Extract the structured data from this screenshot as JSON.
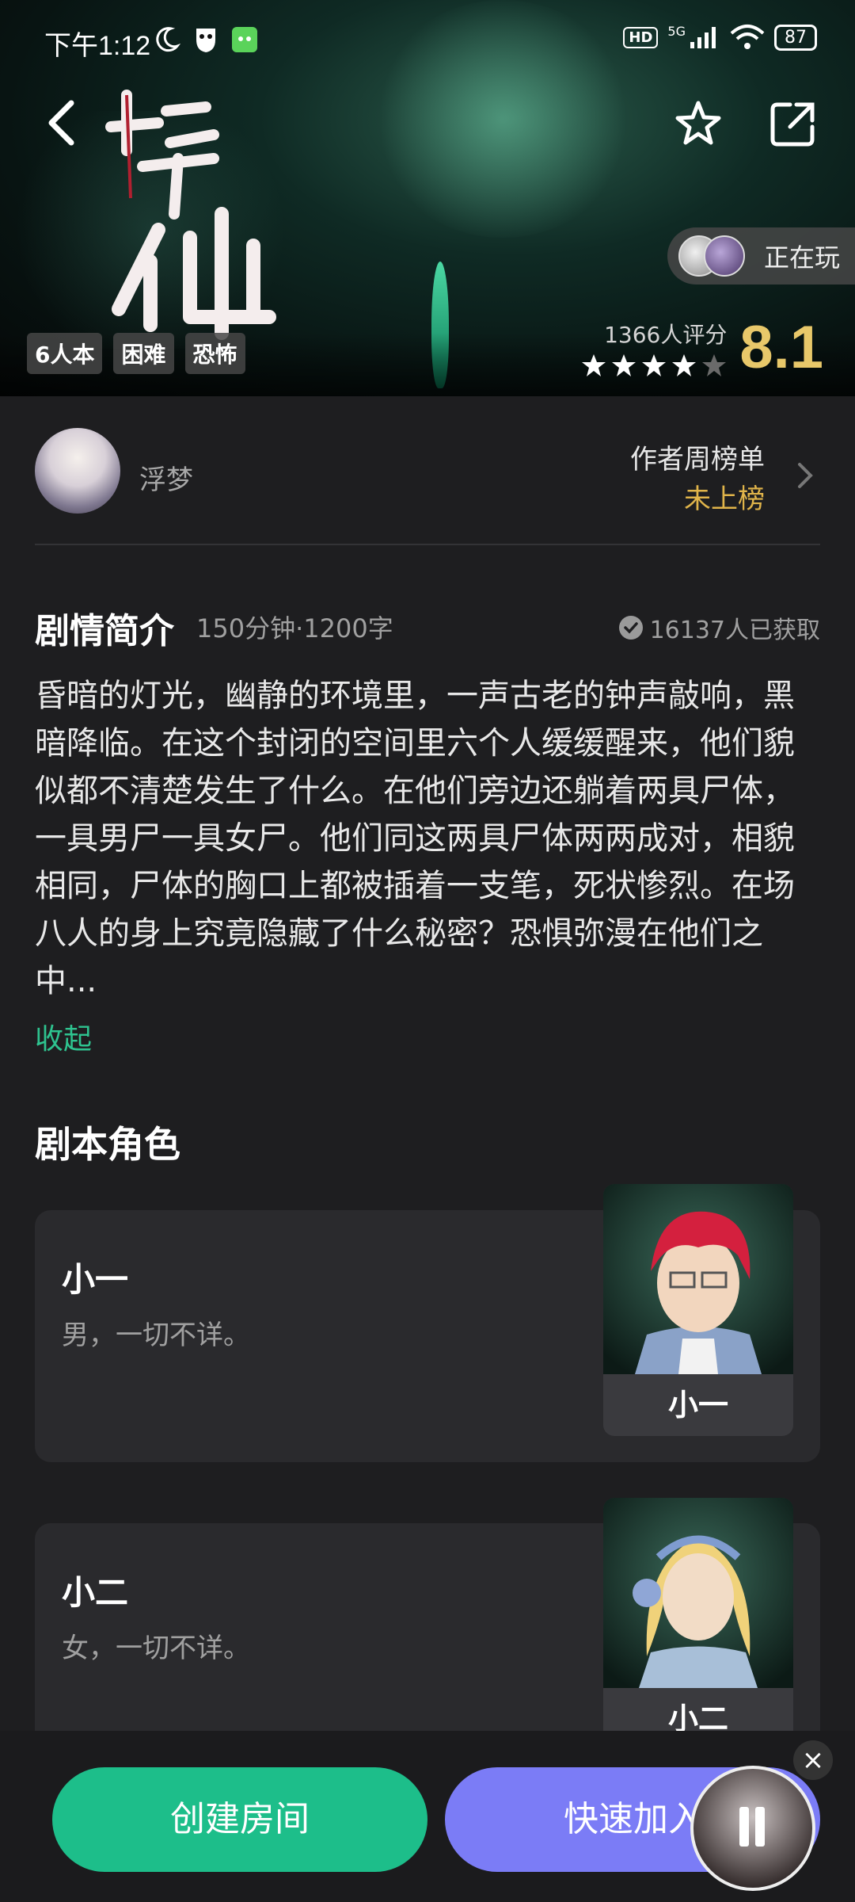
{
  "status_bar": {
    "time": "下午1:12",
    "signal": "5G",
    "hd": "HD",
    "battery": "87"
  },
  "hero": {
    "playing_label": "正在玩",
    "tags": [
      "6人本",
      "困难",
      "恐怖"
    ],
    "rating_count": "1366人评分",
    "rating_score": "8.1",
    "stars_filled": 4,
    "stars_total": 5
  },
  "author": {
    "name": "浮梦",
    "rank_title": "作者周榜单",
    "rank_status": "未上榜"
  },
  "synopsis": {
    "heading": "剧情简介",
    "meta": "150分钟·1200字",
    "acquired": "16137人已获取",
    "text": "昏暗的灯光，幽静的环境里，一声古老的钟声敲响，黑暗降临。在这个封闭的空间里六个人缓缓醒来，他们貌似都不清楚发生了什么。在他们旁边还躺着两具尸体，一具男尸一具女尸。他们同这两具尸体两两成对，相貌相同，尸体的胸口上都被插着一支笔，死状惨烈。在场八人的身上究竟隐藏了什么秘密？恐惧弥漫在他们之中...",
    "collapse": "收起"
  },
  "roles": {
    "heading": "剧本角色",
    "items": [
      {
        "name": "小一",
        "desc": "男，一切不详。",
        "portrait_label": "小一"
      },
      {
        "name": "小二",
        "desc": "女，一切不详。",
        "portrait_label": "小二"
      }
    ]
  },
  "actions": {
    "create": "创建房间",
    "join": "快速加入"
  },
  "colors": {
    "accent_green": "#1dbe8a",
    "accent_purple": "#7b7cf6",
    "rating_gold": "#e8c86a",
    "rank_gold": "#e0b44a"
  }
}
